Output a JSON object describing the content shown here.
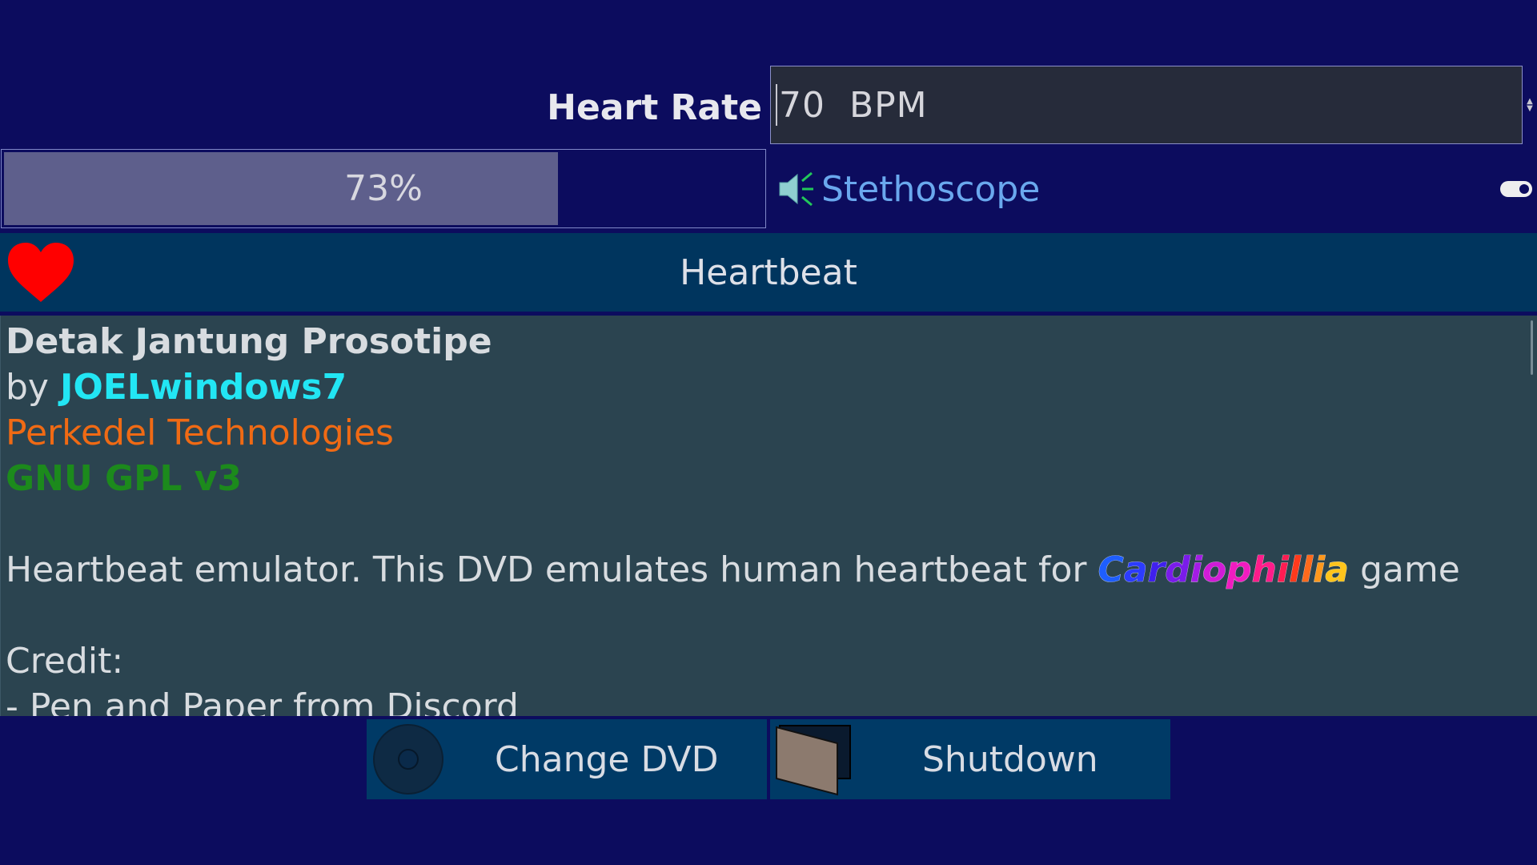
{
  "heart_rate": {
    "label": "Heart Rate",
    "value": "70  BPM"
  },
  "progress": {
    "percent": 73,
    "text": "73%"
  },
  "stethoscope": {
    "icon": "speaker-icon",
    "label": "Stethoscope",
    "toggle_on": true
  },
  "header": {
    "title": "Heartbeat",
    "icon": "heart-icon",
    "icon_color": "#ff0000"
  },
  "info": {
    "title": "Detak Jantung Prosotipe",
    "by_prefix": "by",
    "author": "JOELwindows7",
    "company": "Perkedel Technologies",
    "license": "GNU GPL v3",
    "description_prefix": "Heartbeat emulator. This DVD emulates human heartbeat for",
    "game_name": [
      "C",
      "a",
      "r",
      "d",
      "i",
      "o",
      "p",
      "h",
      "i",
      "l",
      "l",
      "i",
      "a"
    ],
    "game_colors": [
      "#1e5eff",
      "#2c3cff",
      "#4020ee",
      "#7a1cea",
      "#a41ce6",
      "#d01cd8",
      "#f01cc0",
      "#ff1c8a",
      "#ff1c52",
      "#ff3a1c",
      "#ff6a1c",
      "#ff981c",
      "#ffc41c"
    ],
    "description_suffix": "game",
    "credit_heading": "Credit:",
    "credit_line_1": "- Pen and Paper from Discord"
  },
  "buttons": {
    "change_dvd": "Change DVD",
    "shutdown": "Shutdown"
  },
  "colors": {
    "background": "#0c0c5e",
    "panel": "#2b4450",
    "header": "#00355e",
    "author": "#22e6f4",
    "company": "#f06a14",
    "license": "#1c8a1c"
  }
}
